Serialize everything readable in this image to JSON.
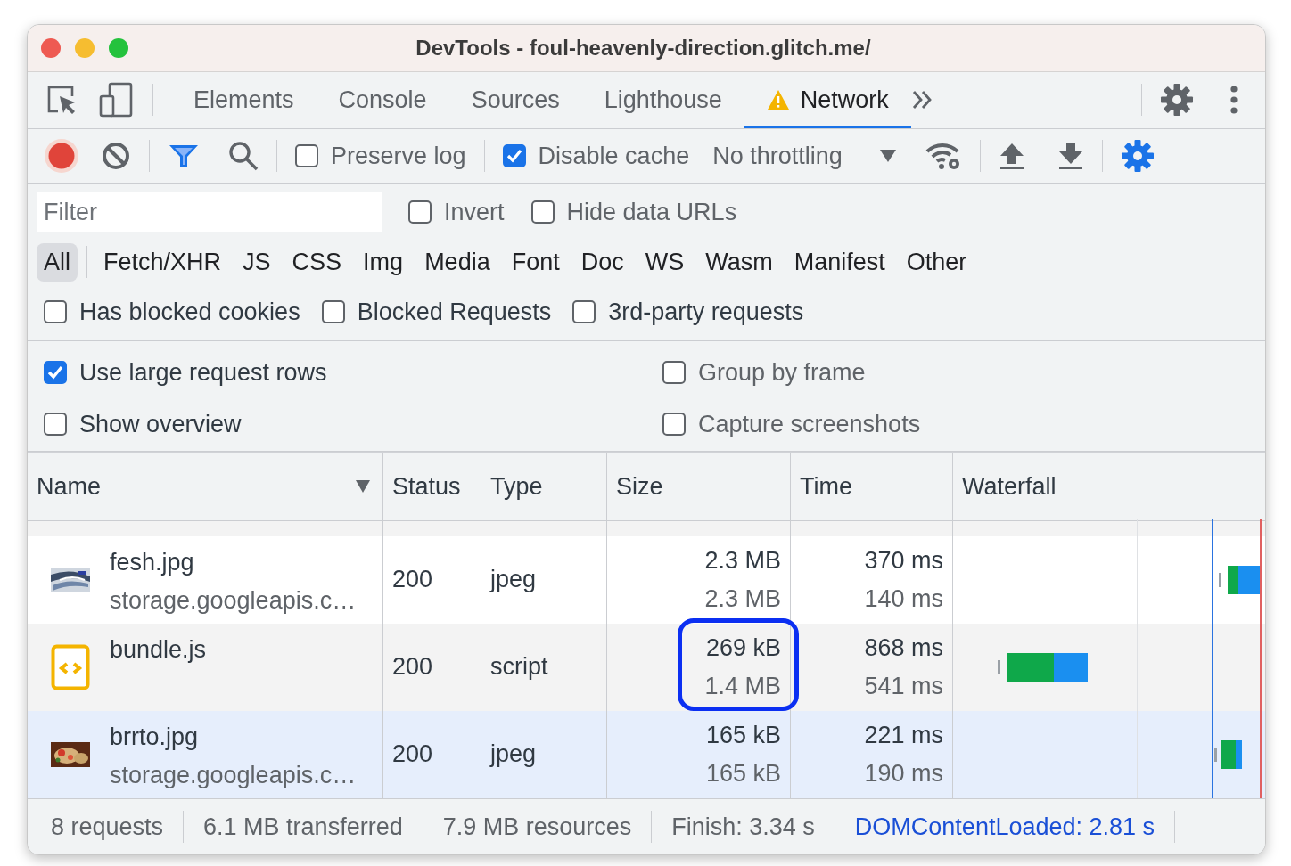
{
  "window": {
    "title": "DevTools - foul-heavenly-direction.glitch.me/"
  },
  "tabs": [
    {
      "label": "Elements",
      "selected": false,
      "warning": false
    },
    {
      "label": "Console",
      "selected": false,
      "warning": false
    },
    {
      "label": "Sources",
      "selected": false,
      "warning": false
    },
    {
      "label": "Lighthouse",
      "selected": false,
      "warning": false
    },
    {
      "label": "Network",
      "selected": true,
      "warning": true
    }
  ],
  "toolbar": {
    "recording": true,
    "preserve_log": {
      "label": "Preserve log",
      "checked": false
    },
    "disable_cache": {
      "label": "Disable cache",
      "checked": true
    },
    "throttling": "No throttling"
  },
  "filter": {
    "placeholder": "Filter",
    "invert": {
      "label": "Invert",
      "checked": false
    },
    "hide_data_urls": {
      "label": "Hide data URLs",
      "checked": false
    }
  },
  "types": [
    {
      "label": "All",
      "selected": true
    },
    {
      "label": "Fetch/XHR",
      "selected": false
    },
    {
      "label": "JS",
      "selected": false
    },
    {
      "label": "CSS",
      "selected": false
    },
    {
      "label": "Img",
      "selected": false
    },
    {
      "label": "Media",
      "selected": false
    },
    {
      "label": "Font",
      "selected": false
    },
    {
      "label": "Doc",
      "selected": false
    },
    {
      "label": "WS",
      "selected": false
    },
    {
      "label": "Wasm",
      "selected": false
    },
    {
      "label": "Manifest",
      "selected": false
    },
    {
      "label": "Other",
      "selected": false
    }
  ],
  "filter_checkboxes": [
    {
      "label": "Has blocked cookies",
      "checked": false
    },
    {
      "label": "Blocked Requests",
      "checked": false
    },
    {
      "label": "3rd-party requests",
      "checked": false
    }
  ],
  "settings": [
    {
      "label": "Use large request rows",
      "checked": true
    },
    {
      "label": "Group by frame",
      "checked": false
    },
    {
      "label": "Show overview",
      "checked": false
    },
    {
      "label": "Capture screenshots",
      "checked": false
    }
  ],
  "table": {
    "columns": [
      "Name",
      "Status",
      "Type",
      "Size",
      "Time",
      "Waterfall"
    ],
    "rows": [
      {
        "name": "fesh.jpg",
        "url": "storage.googleapis.c…",
        "status": "200",
        "type": "jpeg",
        "size": "2.3 MB",
        "resource_size": "2.3 MB",
        "time": "370 ms",
        "latency": "140 ms",
        "highlighted": false,
        "selected": false
      },
      {
        "kind": "script",
        "name": "bundle.js",
        "status": "200",
        "type": "script",
        "size": "269 kB",
        "resource_size": "1.4 MB",
        "time": "868 ms",
        "latency": "541 ms",
        "highlighted": true,
        "selected": false
      },
      {
        "name": "brrto.jpg",
        "url": "storage.googleapis.c…",
        "status": "200",
        "type": "jpeg",
        "size": "165 kB",
        "resource_size": "165 kB",
        "time": "221 ms",
        "latency": "190 ms",
        "highlighted": false,
        "selected": true
      }
    ]
  },
  "status_bar": [
    {
      "kind": "plain",
      "text": "8 requests"
    },
    {
      "kind": "plain",
      "text": "6.1 MB transferred"
    },
    {
      "kind": "plain",
      "text": "7.9 MB resources"
    },
    {
      "kind": "plain",
      "text": "Finish: 3.34 s"
    },
    {
      "kind": "dom",
      "text": "DOMContentLoaded: 2.81 s"
    }
  ]
}
